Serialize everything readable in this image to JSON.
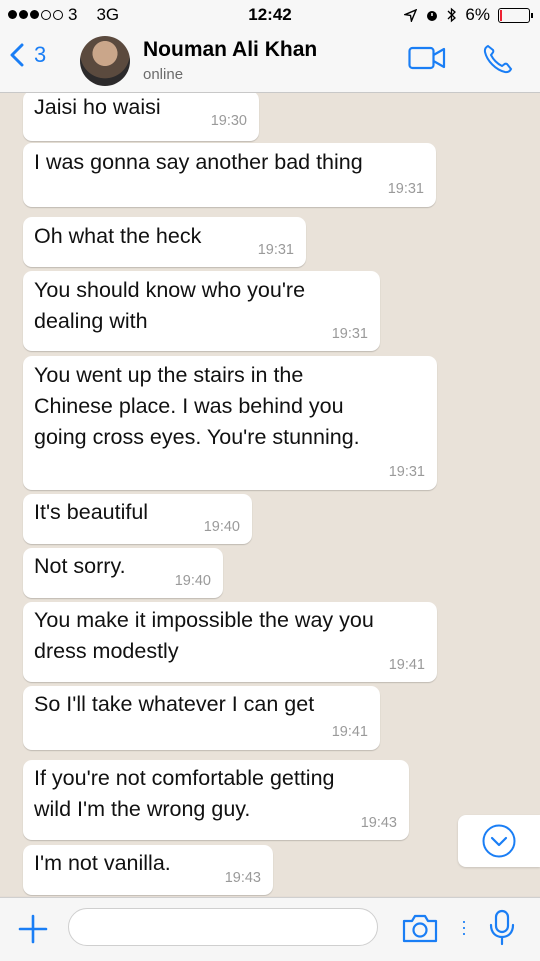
{
  "status_bar": {
    "carrier": "3",
    "network": "3G",
    "time": "12:42",
    "battery": "6%"
  },
  "header": {
    "back_count": "3",
    "contact_name": "Nouman Ali Khan",
    "contact_status": "online"
  },
  "messages": [
    {
      "text": "Jaisi ho waisi",
      "time": "19:30"
    },
    {
      "text": "I was gonna say another bad thing",
      "time": "19:31"
    },
    {
      "text": "Oh what the heck",
      "time": "19:31"
    },
    {
      "text": "You should know who you're\ndealing with",
      "time": "19:31"
    },
    {
      "text": "You went up the stairs in the\nChinese place. I was behind you\ngoing cross eyes. You're stunning.",
      "time": "19:31"
    },
    {
      "text": "It's beautiful",
      "time": "19:40"
    },
    {
      "text": "Not sorry.",
      "time": "19:40"
    },
    {
      "text": "You make it impossible the way you\ndress modestly",
      "time": "19:41"
    },
    {
      "text": "So I'll take whatever I can get",
      "time": "19:41"
    },
    {
      "text": "If you're not comfortable getting\nwild I'm the wrong guy.",
      "time": "19:43"
    },
    {
      "text": "I'm not vanilla.",
      "time": "19:43"
    }
  ],
  "input": {
    "placeholder": "",
    "value": ""
  },
  "colors": {
    "accent": "#1a7ef5",
    "bubble": "#ffffff",
    "chat_bg": "#e9e2d9",
    "timestamp": "#9a9a9a"
  },
  "icons": [
    "back-chevron-icon",
    "video-camera-icon",
    "phone-icon",
    "scroll-down-icon",
    "plus-icon",
    "camera-icon",
    "microphone-icon"
  ]
}
